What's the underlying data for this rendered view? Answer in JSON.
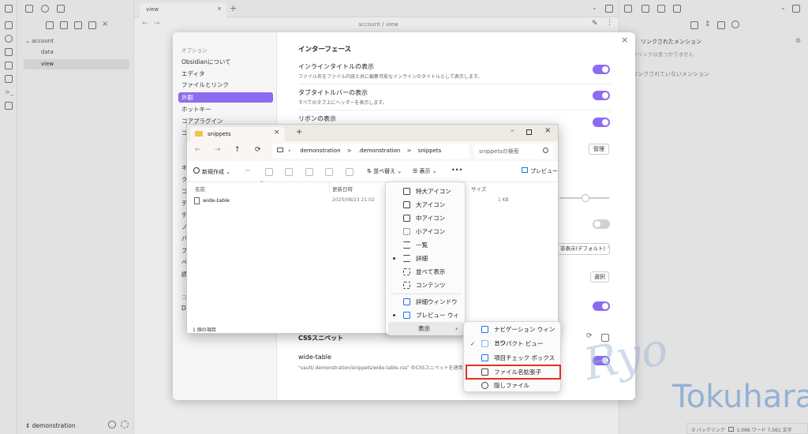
{
  "obsidian": {
    "tab_title": "view",
    "breadcrumb": [
      "account",
      "/",
      "view"
    ],
    "tree": {
      "root": "account",
      "items": [
        "data",
        "view"
      ]
    },
    "vault_name": "demonstration",
    "right_panel": {
      "title": "リンクされたメンション",
      "empty": "バックリンクは見つかりません。",
      "unlinked": "リンクされていないメンション"
    },
    "status_bar": {
      "backlinks": "0 バックリンク",
      "words": "1,066 ワード",
      "chars": "7,561 文字"
    },
    "accent": "#8b6cf0"
  },
  "settings": {
    "section_label": "オプション",
    "nav": [
      "Obsidianについて",
      "エディタ",
      "ファイルとリンク",
      "外観",
      "ホットキー",
      "コアプラグイン",
      "コ"
    ],
    "nav_partial": [
      "キ",
      "ク",
      "コ",
      "デ",
      "デ",
      "ノ",
      "パ",
      "プ",
      "ペ",
      "読"
    ],
    "nav_extra_label": "コ",
    "nav_extra_item": "D",
    "heading": "インターフェース",
    "rows": [
      {
        "title": "インラインタイトルの表示",
        "desc": "ファイル名をファイル内容と共に編集可能なインラインのタイトルとして表示します。"
      },
      {
        "title": "タブタイトルバーの表示",
        "desc": "すべてのタブ上にヘッダーを表示します。"
      },
      {
        "title": "リボンの表示",
        "desc": ""
      }
    ],
    "manage_button": "管理",
    "select_value": "非表示(デフォルト)",
    "choose_button": "選択",
    "css_heading": "CSSスニペット",
    "snippet_name": "wide-table",
    "snippet_desc": "\"vault/.demonstration/snippets/wide-table.css\" のCSSスニペットを適用しま"
  },
  "explorer": {
    "tab_title": "snippets",
    "path": [
      "demonstration",
      ">",
      ".demonstration",
      ">",
      "snippets"
    ],
    "search_placeholder": "snippetsの検索",
    "toolbar": {
      "new": "新規作成",
      "sort": "並べ替え",
      "view": "表示",
      "more": "•••",
      "preview": "プレビュー"
    },
    "columns": [
      "名前",
      "更新日時",
      "サイズ"
    ],
    "files": [
      {
        "name": "wide-table",
        "modified": "2025/08/23 21:02",
        "size": "1 KB"
      }
    ],
    "status": "1 個の項目"
  },
  "view_menu": {
    "items": [
      "特大アイコン",
      "大アイコン",
      "中アイコン",
      "小アイコン",
      "一覧",
      "詳細",
      "並べて表示",
      "コンテンツ",
      "詳細ウィンドウ",
      "プレビュー ウィンドウ",
      "表示"
    ],
    "submenu": [
      "ナビゲーション ウィンドウ",
      "コンパクト ビュー",
      "項目チェック ボックス",
      "ファイル名拡張子",
      "隠しファイル"
    ]
  },
  "watermark": {
    "signature": "Ryo",
    "name": "Tokuhara"
  }
}
